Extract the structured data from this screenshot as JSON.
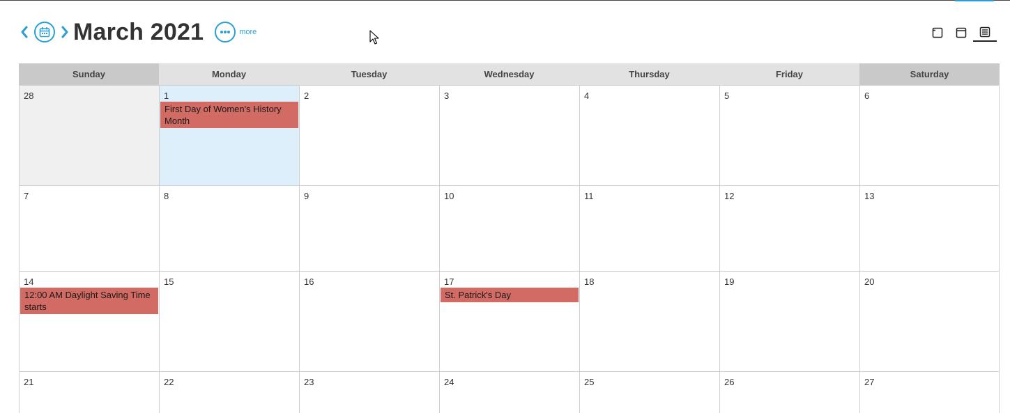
{
  "header": {
    "month_title": "March 2021",
    "more_label": "more"
  },
  "colors": {
    "accent": "#2a9fd6",
    "event": "#d26b63",
    "today": "#ddeffa",
    "other_month": "#f0f0f0",
    "weekday_header": "#e2e2e2",
    "weekend_header": "#c9c9c9"
  },
  "view_switch": [
    {
      "icon": "day-view-icon",
      "active": false
    },
    {
      "icon": "week-view-icon",
      "active": false
    },
    {
      "icon": "month-view-icon",
      "active": true
    }
  ],
  "days_of_week": [
    "Sunday",
    "Monday",
    "Tuesday",
    "Wednesday",
    "Thursday",
    "Friday",
    "Saturday"
  ],
  "weeks": [
    [
      {
        "num": "28",
        "other": true
      },
      {
        "num": "1",
        "today": true,
        "events": [
          "First Day of Women's History Month"
        ]
      },
      {
        "num": "2"
      },
      {
        "num": "3"
      },
      {
        "num": "4"
      },
      {
        "num": "5"
      },
      {
        "num": "6"
      }
    ],
    [
      {
        "num": "7"
      },
      {
        "num": "8"
      },
      {
        "num": "9"
      },
      {
        "num": "10"
      },
      {
        "num": "11"
      },
      {
        "num": "12"
      },
      {
        "num": "13"
      }
    ],
    [
      {
        "num": "14",
        "events": [
          "12:00 AM Daylight Saving Time starts"
        ]
      },
      {
        "num": "15"
      },
      {
        "num": "16"
      },
      {
        "num": "17",
        "events": [
          "St. Patrick's Day"
        ]
      },
      {
        "num": "18"
      },
      {
        "num": "19"
      },
      {
        "num": "20"
      }
    ],
    [
      {
        "num": "21"
      },
      {
        "num": "22"
      },
      {
        "num": "23"
      },
      {
        "num": "24"
      },
      {
        "num": "25"
      },
      {
        "num": "26"
      },
      {
        "num": "27"
      }
    ]
  ]
}
